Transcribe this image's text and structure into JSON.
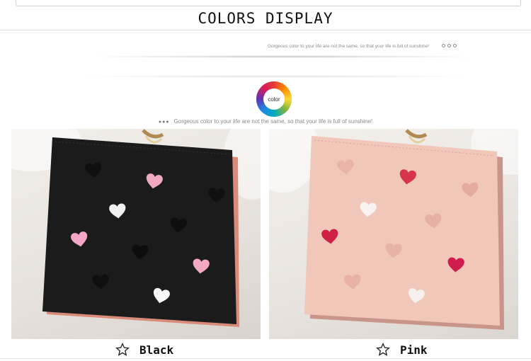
{
  "header": {
    "title": "COLORS DISPLAY",
    "tagline_small": "Gorgeous color to your life are not the same, so that your life is full of sunshine!"
  },
  "color_badge": {
    "label": "color",
    "tagline": "Gorgeous color to your life are not the same, so that your life is full of sunshine!"
  },
  "products": [
    {
      "label": "Black",
      "wallet_color": "#161616",
      "icon": "star-outline-icon"
    },
    {
      "label": "Pink",
      "wallet_color": "#f0c4b6",
      "icon": "star-outline-icon"
    }
  ]
}
